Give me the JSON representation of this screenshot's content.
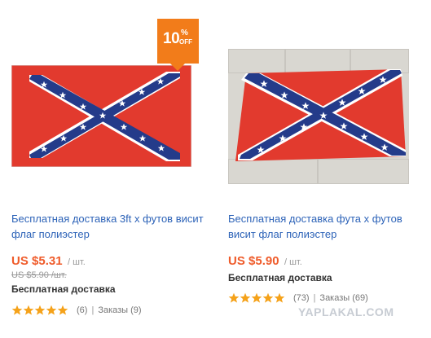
{
  "products": [
    {
      "title": "Бесплатная доставка 3ft х футов висит флаг полиэстер",
      "price": "US $5.31",
      "unit": "/ шт.",
      "old_price": "US $5.90 /шт.",
      "shipping": "Бесплатная доставка",
      "rating": 5,
      "reviews": "(6)",
      "orders": "Заказы (9)",
      "badge": {
        "percent": "10",
        "pct_sign": "%",
        "off": "OFF"
      }
    },
    {
      "title": "Бесплатная доставка фута х футов висит флаг полиэстер",
      "price": "US $5.90",
      "unit": "/ шт.",
      "shipping": "Бесплатная доставка",
      "rating": 5,
      "reviews": "(73)",
      "orders": "Заказы (69)"
    }
  ],
  "separator": "|",
  "watermark": "YAPLAKAL.COM",
  "colors": {
    "link": "#2d63b8",
    "price": "#ef5b2a",
    "star": "#f5a21a",
    "badge": "#f27c1a",
    "flag_red": "#e23a2e",
    "flag_blue": "#243b8a"
  }
}
